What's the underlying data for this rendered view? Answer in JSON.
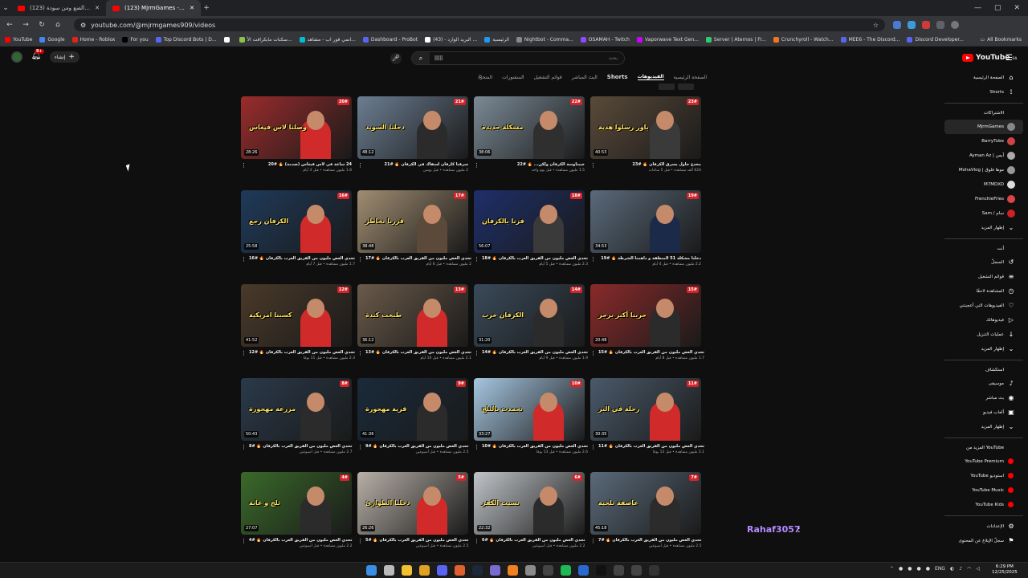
{
  "browser": {
    "tabs": [
      {
        "title": "(123) من رجال الضع ومن سودة ..."
      },
      {
        "title": "(123) MjrmGames - YouTube"
      }
    ],
    "url": "youtube.com/@mjrmgames909/videos",
    "bookmarks": [
      "YouTube",
      "Google",
      "Home - Roblox",
      "For you",
      "Top Discord Bots | D...",
      "",
      "سكنات مايكرافت الأ...",
      "انمي فور اب - مشاهد...",
      "Dashboard - ProBot",
      "(43) - البريد الوارد ...",
      "الرئيسية",
      "Nightbot - Comma...",
      "OSAMAH - Twitch",
      "Vaporwave Text Gen...",
      "Server | Aternos | Fr...",
      "Crunchyroll - Watch...",
      "MEE6 - The Discord...",
      "Discord Developer..."
    ],
    "all_bookmarks": "All Bookmarks"
  },
  "masthead": {
    "create_label": "إنشاء",
    "notif_count": "9+",
    "search_value": "|||||",
    "search_placeholder": "بحث",
    "logo_text": "YouTube",
    "logo_region": "SA"
  },
  "channel_tabs": [
    "الصفحة الرئيسية",
    "الفيديوهات",
    "Shorts",
    "البث المباشر",
    "قوائم التشغيل",
    "المنشورات",
    "المتجر"
  ],
  "videos": [
    {
      "title": "24 ساعة في لاس فيغاس (صدمة) 🔥 #20",
      "stats": "1.8 مليون مشاهدة • قبل 3 أيام",
      "duration": "28:26",
      "ep": "20#",
      "caption": "وصلنا لاس فيغاس",
      "bg": "#9a2c2c",
      "shirt": "#d12a2a"
    },
    {
      "title": "سرقنا كارفان لسفاك في الكرفان 🔥 #21",
      "stats": "2 مليون مشاهدة • قبل يومين",
      "duration": "48:12",
      "ep": "21#",
      "caption": "دخلنا السويد",
      "bg": "#6c7e92",
      "shirt": "#2b2b2b"
    },
    {
      "title": "خيبتاوسة الكرفان ولكن... 🔥 #22",
      "stats": "1.5 مليون مشاهدة • قبل يوم واحد",
      "duration": "38:06",
      "ep": "22#",
      "caption": "مشكلة جديدة",
      "bg": "#7b8a96",
      "shirt": "#2f2f2f"
    },
    {
      "title": "مخدع حاول يسرق الكرفان 🔥 #23",
      "stats": "624 ألف مشاهدة • قبل 5 ساعات",
      "duration": "40:53",
      "ep": "23#",
      "caption": "باور رسلوا هدية",
      "bg": "#5a4a3a",
      "shirt": "#3a3a3a"
    },
    {
      "title": "تحدي العض مليون من الفريق العرب بالكرفان 🔥 #16",
      "stats": "1.7 مليون مشاهدة • قبل 7 أيام",
      "duration": "25:58",
      "ep": "16#",
      "caption": "الكرفان رجع",
      "bg": "#1f3a5a",
      "shirt": "#d12a2a"
    },
    {
      "title": "تحدي العض مليون من الفريق العرب بالكرفان 🔥 #17",
      "stats": "2 مليون مشاهدة • قبل 6 أيام",
      "duration": "38:48",
      "ep": "17#",
      "caption": "قررنا نخاطر",
      "bg": "#a08d72",
      "shirt": "#5b4a3a"
    },
    {
      "title": "تحدي العض مليون من الفريق العرب بالكرفان 🔥 #18",
      "stats": "2.3 مليون مشاهدة • قبل 5 أيام",
      "duration": "56:07",
      "ep": "18#",
      "caption": "فزنا بالكرفان",
      "bg": "#1e2f6a",
      "shirt": "#3a3a3a"
    },
    {
      "title": "دخلنا مشكلة 51 المنطقة و داهمنا الشرطة 🔥 #19",
      "stats": "2.2 مليون مشاهدة • قبل 4 أيام",
      "duration": "34:53",
      "ep": "19#",
      "caption": "",
      "bg": "#5a6a7a",
      "shirt": "#1c2a4a"
    },
    {
      "title": "تحدي العض مليون من الفريق العرب بالكرفان 🔥 #12",
      "stats": "2.3 مليون مشاهدة • قبل 11 يومًا",
      "duration": "41:52",
      "ep": "12#",
      "caption": "كسبنا امريكية",
      "bg": "#4a3a2a",
      "shirt": "#d12a2a"
    },
    {
      "title": "تحدي العض مليون من الفريق العرب بالكرفان 🔥 #13",
      "stats": "2.1 مليون مشاهدة • قبل 10 أيام",
      "duration": "36:12",
      "ep": "13#",
      "caption": "طبخت كبدة",
      "bg": "#6a5a4a",
      "shirt": "#d12a2a"
    },
    {
      "title": "تحدي العض مليون من الفريق العرب بالكرفان 🔥 #14",
      "stats": "1.9 مليون مشاهدة • قبل 9 أيام",
      "duration": "31:20",
      "ep": "14#",
      "caption": "الكرفان خرب",
      "bg": "#3a4a5a",
      "shirt": "#2b2b2b"
    },
    {
      "title": "تحدي العض مليون من الفريق العرب بالكرفان 🔥 #15",
      "stats": "1.7 مليون مشاهدة • قبل 8 أيام",
      "duration": "20:48",
      "ep": "15#",
      "caption": "جربنا أكبر برجر",
      "bg": "#8a2a2a",
      "shirt": "#2b2b2b"
    },
    {
      "title": "تحدي العض مليون من الفريق العرب بالكرفان 🔥 #8",
      "stats": "2.7 مليون مشاهدة • قبل أسبوعين",
      "duration": "50:43",
      "ep": "8#",
      "caption": "مزرعة مهجورة",
      "bg": "#2a3a4a",
      "shirt": "#2b2b2b"
    },
    {
      "title": "تحدي العض مليون من الفريق العرب بالكرفان 🔥 #9",
      "stats": "2.5 مليون مشاهدة • قبل أسبوعين",
      "duration": "41:36",
      "ep": "9#",
      "caption": "قرية مهجورة",
      "bg": "#1a2a3a",
      "shirt": "#2b2b2b"
    },
    {
      "title": "تحدي العض مليون من الفريق العرب بالكرفان 🔥 #10",
      "stats": "2.6 مليون مشاهدة • قبل 13 يومًا",
      "duration": "33:27",
      "ep": "10#",
      "caption": "تجمدت بالثلج",
      "bg": "#a6c6e0",
      "shirt": "#d12a2a"
    },
    {
      "title": "تحدي العض مليون من الفريق العرب بالكرفان 🔥 #11",
      "stats": "2.1 مليون مشاهدة • قبل 12 يومًا",
      "duration": "30:35",
      "ep": "11#",
      "caption": "رحلة في البر",
      "bg": "#4a5a6a",
      "shirt": "#d12a2a"
    },
    {
      "title": "تحدي العض مليون من الفريق العرب بالكرفان 🔥 #4",
      "stats": "2.2 مليون مشاهدة • قبل أسبوعين",
      "duration": "27:07",
      "ep": "4#",
      "caption": "ثلج و غابة",
      "bg": "#3a6a2a",
      "shirt": "#2b2b2b"
    },
    {
      "title": "تحدي العض مليون من الفريق العرب بالكرفان 🔥 #5",
      "stats": "2.5 مليون مشاهدة • قبل أسبوعين",
      "duration": "26:26",
      "ep": "5#",
      "caption": "دخلنا الطوارئ",
      "bg": "#b8b0a8",
      "shirt": "#d12a2a"
    },
    {
      "title": "تحدي العض مليون من الفريق العرب بالكرفان 🔥 #6",
      "stats": "2.2 مليون مشاهدة • قبل أسبوعين",
      "duration": "22:32",
      "ep": "6#",
      "caption": "نسيت الكفر",
      "bg": "#c0c4c8",
      "shirt": "#2b2b2b"
    },
    {
      "title": "تحدي العض مليون من الفريق العرب بالكرفان 🔥 #7",
      "stats": "2.5 مليون مشاهدة • قبل أسبوعين",
      "duration": "45:18",
      "ep": "7#",
      "caption": "عاصفة ثلجية",
      "bg": "#5a6a7a",
      "shirt": "#2b2b2b"
    }
  ],
  "sidebar": {
    "main": [
      {
        "label": "الصفحة الرئيسية",
        "icon": "home-icon",
        "glyph": "⌂"
      },
      {
        "label": "Shorts",
        "icon": "shorts-icon",
        "glyph": "⟟"
      }
    ],
    "subs_title": "الاشتراكات",
    "subs": [
      {
        "label": "MjrmGames",
        "color": "#888",
        "selected": true
      },
      {
        "label": "BarryTube",
        "color": "#c44"
      },
      {
        "label": "Ayman Az | أيمن",
        "color": "#aaa"
      },
      {
        "label": "MohaVlog | موها فلوق",
        "color": "#999"
      },
      {
        "label": "M7MDXO",
        "color": "#ddd"
      },
      {
        "label": "FrenchieFries",
        "color": "#d44"
      },
      {
        "label": "Sam / سام",
        "color": "#c22"
      }
    ],
    "show_more": "إظهار المزيد",
    "you_title": "أنت",
    "you": [
      {
        "label": "السجلّ",
        "icon": "history-icon",
        "glyph": "↺"
      },
      {
        "label": "قوائم التشغيل",
        "icon": "playlists-icon",
        "glyph": "≡"
      },
      {
        "label": "المشاهدة لاحقًا",
        "icon": "watch-later-icon",
        "glyph": "◷"
      },
      {
        "label": "الفيديوهات التي أعجبتني",
        "icon": "like-icon",
        "glyph": "♡"
      },
      {
        "label": "فيديوهاتك",
        "icon": "your-videos-icon",
        "glyph": "▷"
      },
      {
        "label": "عمليات التنزيل",
        "icon": "download-icon",
        "glyph": "↓"
      },
      {
        "label": "إظهار المزيد",
        "icon": "chevron-down-icon",
        "glyph": "⌄"
      }
    ],
    "explore_title": "استكشاف",
    "explore": [
      {
        "label": "موسيقى",
        "icon": "music-icon",
        "glyph": "♪"
      },
      {
        "label": "بث مباشر",
        "icon": "live-icon",
        "glyph": "◉"
      },
      {
        "label": "ألعاب فيديو",
        "icon": "gaming-icon",
        "glyph": "▣"
      },
      {
        "label": "إظهار المزيد",
        "icon": "chevron-down-icon",
        "glyph": "⌄"
      }
    ],
    "more_title": "المزيد من YouTube",
    "more": [
      {
        "label": "YouTube Premium",
        "icon": "premium-icon"
      },
      {
        "label": "YouTube استوديو",
        "icon": "studio-icon"
      },
      {
        "label": "YouTube Music",
        "icon": "yt-music-icon"
      },
      {
        "label": "YouTube Kids",
        "icon": "yt-kids-icon"
      }
    ],
    "settings": [
      {
        "label": "الإعدادات",
        "icon": "gear-icon",
        "glyph": "⚙"
      },
      {
        "label": "سجلّ الإبلاغ عن المحتوى",
        "icon": "flag-icon",
        "glyph": "⚑"
      }
    ]
  },
  "overlay_text": "Rahaf3057",
  "taskbar": {
    "time": "6:29 PM",
    "date": "12/25/2025",
    "lang": "ENG"
  }
}
